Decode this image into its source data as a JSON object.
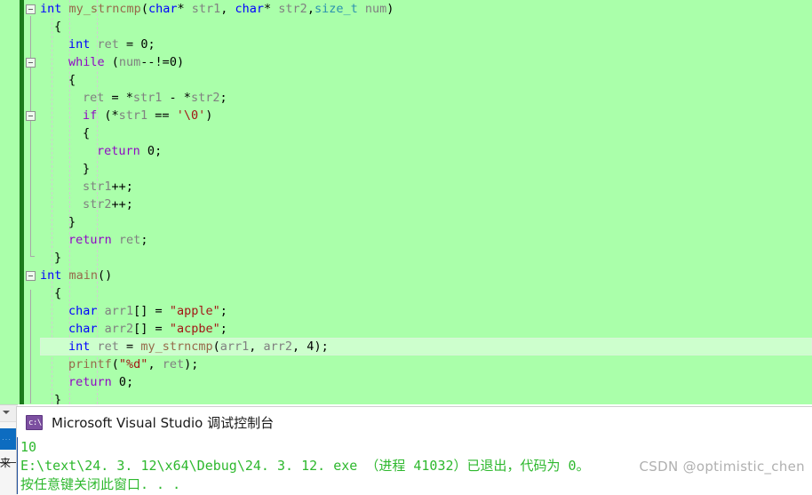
{
  "editor": {
    "background_color": "#aaffaa",
    "change_bar_color": "#1a7a1a",
    "current_line_color": "#cdffcd",
    "lines": [
      {
        "n": 1,
        "indent": 0,
        "tokens": [
          {
            "t": "int",
            "c": "kw"
          },
          {
            "t": " ",
            "c": "pun"
          },
          {
            "t": "my_strncmp",
            "c": "fn"
          },
          {
            "t": "(",
            "c": "pun"
          },
          {
            "t": "char",
            "c": "kw"
          },
          {
            "t": "* ",
            "c": "pun"
          },
          {
            "t": "str1",
            "c": "id"
          },
          {
            "t": ", ",
            "c": "pun"
          },
          {
            "t": "char",
            "c": "kw"
          },
          {
            "t": "* ",
            "c": "pun"
          },
          {
            "t": "str2",
            "c": "id"
          },
          {
            "t": ",",
            "c": "pun"
          },
          {
            "t": "size_t",
            "c": "typ"
          },
          {
            "t": " ",
            "c": "pun"
          },
          {
            "t": "num",
            "c": "id"
          },
          {
            "t": ")",
            "c": "pun"
          }
        ]
      },
      {
        "n": 2,
        "indent": 1,
        "tokens": [
          {
            "t": "{",
            "c": "pun"
          }
        ]
      },
      {
        "n": 3,
        "indent": 2,
        "tokens": [
          {
            "t": "int",
            "c": "kw"
          },
          {
            "t": " ",
            "c": "pun"
          },
          {
            "t": "ret",
            "c": "id"
          },
          {
            "t": " = ",
            "c": "pun"
          },
          {
            "t": "0",
            "c": "num"
          },
          {
            "t": ";",
            "c": "pun"
          }
        ]
      },
      {
        "n": 4,
        "indent": 2,
        "tokens": [
          {
            "t": "while",
            "c": "kwp"
          },
          {
            "t": " (",
            "c": "pun"
          },
          {
            "t": "num",
            "c": "id"
          },
          {
            "t": "--!=",
            "c": "pun"
          },
          {
            "t": "0",
            "c": "num"
          },
          {
            "t": ")",
            "c": "pun"
          }
        ]
      },
      {
        "n": 5,
        "indent": 2,
        "tokens": [
          {
            "t": "{",
            "c": "pun"
          }
        ]
      },
      {
        "n": 6,
        "indent": 3,
        "tokens": [
          {
            "t": "ret",
            "c": "id"
          },
          {
            "t": " = *",
            "c": "pun"
          },
          {
            "t": "str1",
            "c": "id"
          },
          {
            "t": " - *",
            "c": "pun"
          },
          {
            "t": "str2",
            "c": "id"
          },
          {
            "t": ";",
            "c": "pun"
          }
        ]
      },
      {
        "n": 7,
        "indent": 3,
        "tokens": [
          {
            "t": "if",
            "c": "kwp"
          },
          {
            "t": " (*",
            "c": "pun"
          },
          {
            "t": "str1",
            "c": "id"
          },
          {
            "t": " == ",
            "c": "pun"
          },
          {
            "t": "'\\0'",
            "c": "str"
          },
          {
            "t": ")",
            "c": "pun"
          }
        ]
      },
      {
        "n": 8,
        "indent": 3,
        "tokens": [
          {
            "t": "{",
            "c": "pun"
          }
        ]
      },
      {
        "n": 9,
        "indent": 4,
        "tokens": [
          {
            "t": "return",
            "c": "kwp"
          },
          {
            "t": " ",
            "c": "pun"
          },
          {
            "t": "0",
            "c": "num"
          },
          {
            "t": ";",
            "c": "pun"
          }
        ]
      },
      {
        "n": 10,
        "indent": 3,
        "tokens": [
          {
            "t": "}",
            "c": "pun"
          }
        ]
      },
      {
        "n": 11,
        "indent": 3,
        "tokens": [
          {
            "t": "str1",
            "c": "id"
          },
          {
            "t": "++;",
            "c": "pun"
          }
        ]
      },
      {
        "n": 12,
        "indent": 3,
        "tokens": [
          {
            "t": "str2",
            "c": "id"
          },
          {
            "t": "++;",
            "c": "pun"
          }
        ]
      },
      {
        "n": 13,
        "indent": 2,
        "tokens": [
          {
            "t": "}",
            "c": "pun"
          }
        ]
      },
      {
        "n": 14,
        "indent": 2,
        "tokens": [
          {
            "t": "return",
            "c": "kwp"
          },
          {
            "t": " ",
            "c": "pun"
          },
          {
            "t": "ret",
            "c": "id"
          },
          {
            "t": ";",
            "c": "pun"
          }
        ]
      },
      {
        "n": 15,
        "indent": 1,
        "tokens": [
          {
            "t": "}",
            "c": "pun"
          }
        ]
      },
      {
        "n": 16,
        "indent": 0,
        "tokens": [
          {
            "t": "int",
            "c": "kw"
          },
          {
            "t": " ",
            "c": "pun"
          },
          {
            "t": "main",
            "c": "fn"
          },
          {
            "t": "()",
            "c": "pun"
          }
        ]
      },
      {
        "n": 17,
        "indent": 1,
        "tokens": [
          {
            "t": "{",
            "c": "pun"
          }
        ]
      },
      {
        "n": 18,
        "indent": 2,
        "tokens": [
          {
            "t": "char",
            "c": "kw"
          },
          {
            "t": " ",
            "c": "pun"
          },
          {
            "t": "arr1",
            "c": "id"
          },
          {
            "t": "[] = ",
            "c": "pun"
          },
          {
            "t": "\"apple\"",
            "c": "str"
          },
          {
            "t": ";",
            "c": "pun"
          }
        ]
      },
      {
        "n": 19,
        "indent": 2,
        "tokens": [
          {
            "t": "char",
            "c": "kw"
          },
          {
            "t": " ",
            "c": "pun"
          },
          {
            "t": "arr2",
            "c": "id"
          },
          {
            "t": "[] = ",
            "c": "pun"
          },
          {
            "t": "\"acpbe\"",
            "c": "str"
          },
          {
            "t": ";",
            "c": "pun"
          }
        ]
      },
      {
        "n": 20,
        "indent": 2,
        "current": true,
        "tokens": [
          {
            "t": "int",
            "c": "kw"
          },
          {
            "t": " ",
            "c": "pun"
          },
          {
            "t": "ret",
            "c": "id"
          },
          {
            "t": " = ",
            "c": "pun"
          },
          {
            "t": "my_strncmp",
            "c": "fn"
          },
          {
            "t": "(",
            "c": "pun"
          },
          {
            "t": "arr1",
            "c": "id"
          },
          {
            "t": ", ",
            "c": "pun"
          },
          {
            "t": "arr2",
            "c": "id"
          },
          {
            "t": ", ",
            "c": "pun"
          },
          {
            "t": "4",
            "c": "num"
          },
          {
            "t": ");",
            "c": "pun"
          }
        ]
      },
      {
        "n": 21,
        "indent": 2,
        "tokens": [
          {
            "t": "printf",
            "c": "fn"
          },
          {
            "t": "(",
            "c": "pun"
          },
          {
            "t": "\"%d\"",
            "c": "str"
          },
          {
            "t": ", ",
            "c": "pun"
          },
          {
            "t": "ret",
            "c": "id"
          },
          {
            "t": ");",
            "c": "pun"
          }
        ]
      },
      {
        "n": 22,
        "indent": 2,
        "tokens": [
          {
            "t": "return",
            "c": "kwp"
          },
          {
            "t": " ",
            "c": "pun"
          },
          {
            "t": "0",
            "c": "num"
          },
          {
            "t": ";",
            "c": "pun"
          }
        ]
      },
      {
        "n": 23,
        "indent": 1,
        "tokens": [
          {
            "t": "}",
            "c": "pun"
          }
        ]
      }
    ],
    "fold_boxes": [
      {
        "line": 1,
        "state": "expanded"
      },
      {
        "line": 4,
        "state": "expanded"
      },
      {
        "line": 7,
        "state": "expanded"
      },
      {
        "line": 16,
        "state": "expanded"
      }
    ]
  },
  "console": {
    "icon": "cmd-prompt-icon",
    "title": "Microsoft Visual Studio 调试控制台",
    "text_color": "#2eb82e",
    "lines": [
      "10",
      "E:\\text\\24. 3. 12\\x64\\Debug\\24. 3. 12. exe （进程 41032）已退出，代码为 0。",
      "按任意键关闭此窗口. . ."
    ]
  },
  "vs_fragment": {
    "label": "来"
  },
  "watermark": {
    "text": "CSDN @optimistic_chen"
  }
}
